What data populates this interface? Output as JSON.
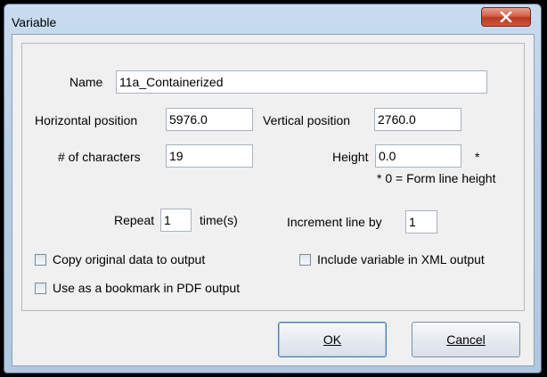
{
  "window": {
    "title": "Variable"
  },
  "form": {
    "name_label": "Name",
    "name_value": "11a_Containerized",
    "hpos_label": "Horizontal position",
    "hpos_value": "5976.0",
    "vpos_label": "Vertical position",
    "vpos_value": "2760.0",
    "chars_label": "# of characters",
    "chars_value": "19",
    "height_label": "Height",
    "height_value": "0.0",
    "height_asterisk": "*",
    "height_note": "* 0 = Form line height",
    "repeat_label": "Repeat",
    "repeat_value": "1",
    "repeat_unit": "time(s)",
    "increment_label": "Increment line by",
    "increment_value": "1"
  },
  "checkboxes": {
    "copy_original": {
      "label": "Copy original data to output",
      "checked": false
    },
    "include_xml": {
      "label": "Include variable in XML output",
      "checked": false
    },
    "bookmark_pdf": {
      "label": "Use as a bookmark in PDF output",
      "checked": false
    }
  },
  "buttons": {
    "ok_label": "OK",
    "cancel_label": "Cancel"
  },
  "icons": {
    "close": "close-icon"
  },
  "colors": {
    "close_button": "#c8452b",
    "frame": "#b7cde5",
    "client_bg": "#f0f0f0"
  }
}
